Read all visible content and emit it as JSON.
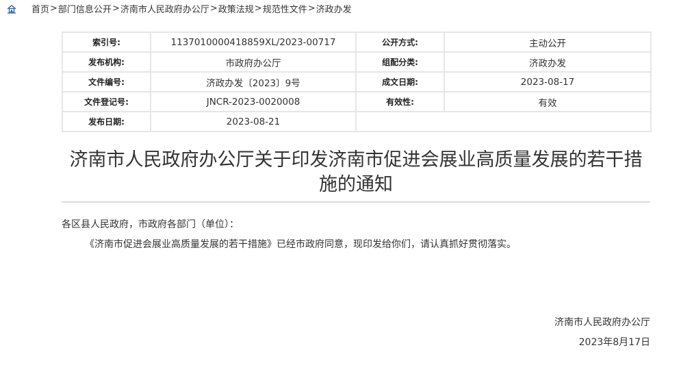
{
  "breadcrumb": {
    "icon": "home-icon",
    "items": [
      "首页",
      "部门信息公开",
      "济南市人民政府办公厅",
      "政策法规",
      "规范性文件",
      "济政办发"
    ],
    "separator": ">"
  },
  "meta": {
    "index_no_label": "索引号:",
    "index_no": "1137010000418859XL/2023-00717",
    "disclosure_label": "公开方式:",
    "disclosure": "主动公开",
    "issuer_label": "发布机构:",
    "issuer": "市政府办公厅",
    "category_label": "组配分类:",
    "category": "济政办发",
    "doc_no_label": "文件编号:",
    "doc_no": "济政办发〔2023〕9号",
    "written_date_label": "成文日期:",
    "written_date": "2023-08-17",
    "reg_no_label": "文件登记号:",
    "reg_no": "JNCR-2023-0020008",
    "validity_label": "有效性:",
    "validity": "有效",
    "publish_date_label": "发布日期:",
    "publish_date": "2023-08-21"
  },
  "document": {
    "title": "济南市人民政府办公厅关于印发济南市促进会展业高质量发展的若干措施的通知",
    "salutation": "各区县人民政府，市政府各部门（单位）：",
    "paragraph": "《济南市促进会展业高质量发展的若干措施》已经市政府同意，现印发给你们，请认真抓好贯彻落实。",
    "signature_org": "济南市人民政府办公厅",
    "signature_date": "2023年8月17日"
  },
  "colors": {
    "home_icon": "#2a5db0",
    "table_border": "#e6e6e6",
    "rule": "#dddddd",
    "text": "#333333"
  }
}
